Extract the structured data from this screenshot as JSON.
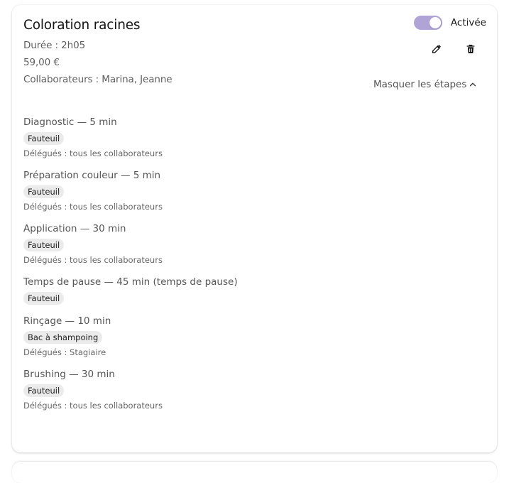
{
  "service": {
    "title": "Coloration racines",
    "duration": "Durée : 2h05",
    "price": "59,00 €",
    "collaborators": "Collaborateurs : Marina, Jeanne",
    "status_label": "Activée",
    "toggle_on": true,
    "toggle_color": "#b0a3d6",
    "edit_icon": "pencil-edit-icon",
    "delete_icon": "trash-icon",
    "steps_toggle_label": "Masquer les étapes",
    "steps_toggle_icon": "chevron-up-icon"
  },
  "steps": [
    {
      "title": "Diagnostic — 5 min",
      "resource": "Fauteuil",
      "delegates": "Délégués : tous les collaborateurs"
    },
    {
      "title": "Préparation couleur — 5 min",
      "resource": "Fauteuil",
      "delegates": "Délégués : tous les collaborateurs"
    },
    {
      "title": "Application — 30 min",
      "resource": "Fauteuil",
      "delegates": "Délégués : tous les collaborateurs"
    },
    {
      "title": "Temps de pause — 45 min (temps de pause)",
      "resource": "Fauteuil",
      "delegates": ""
    },
    {
      "title": "Rinçage — 10 min",
      "resource": "Bac à shampoing",
      "delegates": "Délégués : Stagiaire"
    },
    {
      "title": "Brushing — 30 min",
      "resource": "Fauteuil",
      "delegates": "Délégués : tous les collaborateurs"
    }
  ]
}
